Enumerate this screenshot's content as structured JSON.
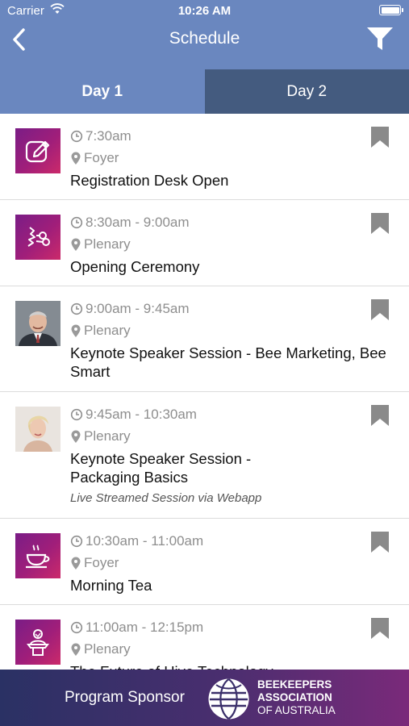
{
  "status_bar": {
    "carrier": "Carrier",
    "time": "10:26 AM"
  },
  "nav": {
    "title": "Schedule"
  },
  "tabs": [
    {
      "label": "Day 1"
    },
    {
      "label": "Day 2"
    }
  ],
  "sessions": [
    {
      "time": "7:30am",
      "location": "Foyer",
      "title": "Registration Desk Open",
      "thumb": "edit-icon"
    },
    {
      "time": "8:30am - 9:00am",
      "location": "Plenary",
      "title": "Opening Ceremony",
      "thumb": "ceremony-icon"
    },
    {
      "time": "9:00am - 9:45am",
      "location": "Plenary",
      "title": "Keynote Speaker Session - Bee Marketing, Bee Smart",
      "thumb": "speaker-photo-man"
    },
    {
      "time": "9:45am - 10:30am",
      "location": "Plenary",
      "title": "Keynote Speaker Session - Packaging Basics",
      "note": "Live Streamed Session via Webapp",
      "thumb": "speaker-photo-woman"
    },
    {
      "time": "10:30am - 11:00am",
      "location": "Foyer",
      "title": "Morning Tea",
      "thumb": "coffee-cup-icon"
    },
    {
      "time": "11:00am - 12:15pm",
      "location": "Plenary",
      "title": "The Future of Hive Technology",
      "thumb": "podium-speaker-icon"
    }
  ],
  "sponsor": {
    "label": "Program Sponsor",
    "name_line1": "BEEKEEPERS",
    "name_line2": "ASSOCIATION",
    "name_line3": "OF AUSTRALIA"
  },
  "colors": {
    "header": "#6a87bf",
    "tab_inactive": "#445b7f",
    "bookmark": "#8a8a8a"
  }
}
